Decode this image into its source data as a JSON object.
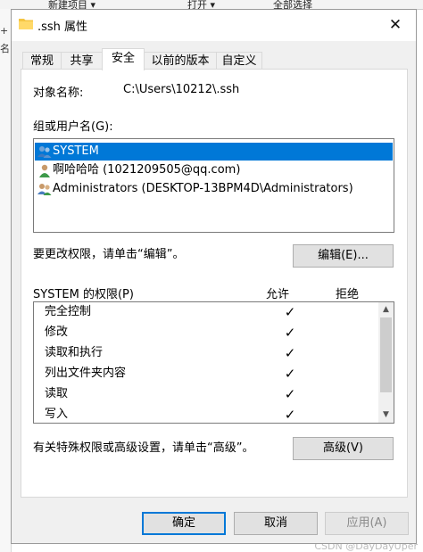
{
  "background": {
    "top_fragments": [
      "新建项目 ▾",
      "打开 ▾",
      "全部选择"
    ],
    "left_fragments": [
      "+",
      "名"
    ],
    "watermark": "CSDN @DayDayUper"
  },
  "dialog": {
    "title": ".ssh 属性",
    "close_glyph": "✕",
    "tabs": [
      "常规",
      "共享",
      "安全",
      "以前的版本",
      "自定义"
    ],
    "active_tab": "安全",
    "object_name_label": "对象名称:",
    "object_name_value": "C:\\Users\\10212\\.ssh",
    "group_label": "组或用户名(G):",
    "users": [
      {
        "name": "SYSTEM",
        "icon": "group-users-icon",
        "selected": true
      },
      {
        "name": "啊哈哈哈 (1021209505@qq.com)",
        "icon": "user-icon",
        "selected": false
      },
      {
        "name": "Administrators (DESKTOP-13BPM4D\\Administrators)",
        "icon": "group-users-icon",
        "selected": false
      }
    ],
    "edit_hint": "要更改权限，请单击“编辑”。",
    "edit_button": "编辑(E)...",
    "perm_header": "SYSTEM 的权限(P)",
    "allow_header": "允许",
    "deny_header": "拒绝",
    "permissions": [
      {
        "name": "完全控制",
        "allow": "✓",
        "deny": ""
      },
      {
        "name": "修改",
        "allow": "✓",
        "deny": ""
      },
      {
        "name": "读取和执行",
        "allow": "✓",
        "deny": ""
      },
      {
        "name": "列出文件夹内容",
        "allow": "✓",
        "deny": ""
      },
      {
        "name": "读取",
        "allow": "✓",
        "deny": ""
      },
      {
        "name": "写入",
        "allow": "✓",
        "deny": ""
      }
    ],
    "advanced_hint": "有关特殊权限或高级设置，请单击“高级”。",
    "advanced_button": "高级(V)",
    "ok_button": "确定",
    "cancel_button": "取消",
    "apply_button": "应用(A)"
  },
  "colors": {
    "selection": "#0078d7",
    "dialog_bg": "#f0f0f0",
    "panel_bg": "#ffffff"
  }
}
